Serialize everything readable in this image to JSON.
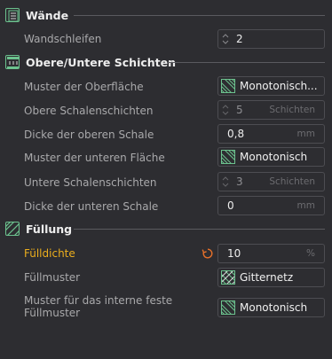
{
  "sections": {
    "walls": {
      "title": "Wände",
      "icon": "walls-icon"
    },
    "shells": {
      "title": "Obere/Untere Schichten",
      "icon": "shells-icon"
    },
    "infill": {
      "title": "Füllung",
      "icon": "infill-icon"
    }
  },
  "walls": {
    "loops": {
      "label": "Wandschleifen",
      "value": "2"
    }
  },
  "shells": {
    "top_pattern": {
      "label": "Muster der Oberfläche",
      "value": "Monotonisch..."
    },
    "top_layers": {
      "label": "Obere Schalenschichten",
      "value": "5",
      "unit": "Schichten"
    },
    "top_thickness": {
      "label": "Dicke der oberen Schale",
      "value": "0,8",
      "unit": "mm"
    },
    "bottom_pattern": {
      "label": "Muster der unteren Fläche",
      "value": "Monotonisch"
    },
    "bottom_layers": {
      "label": "Untere Schalenschichten",
      "value": "3",
      "unit": "Schichten"
    },
    "bottom_thickness": {
      "label": "Dicke der unteren Schale",
      "value": "0",
      "unit": "mm"
    }
  },
  "infill": {
    "density": {
      "label": "Fülldichte",
      "value": "10",
      "unit": "%",
      "reset_icon": "reset-icon"
    },
    "pattern": {
      "label": "Füllmuster",
      "value": "Gitternetz"
    },
    "solid_pattern": {
      "label": "Muster für das interne feste Füllmuster",
      "value": "Monotonisch"
    }
  },
  "colors": {
    "background": "#2d2d31",
    "accent_green": "#6cc28e",
    "modified_label": "#ecae1d",
    "reset_icon": "#e5702a"
  }
}
